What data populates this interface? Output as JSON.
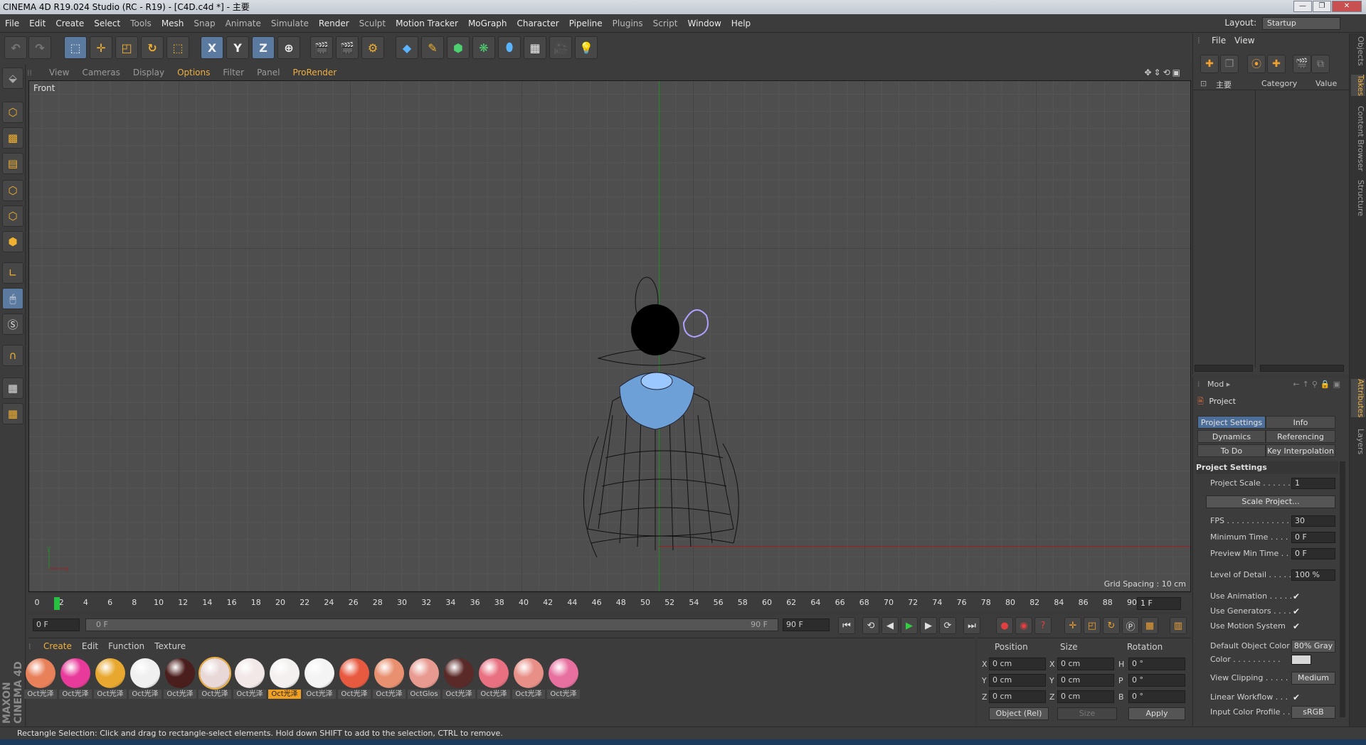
{
  "window": {
    "title": "CINEMA 4D R19.024 Studio (RC - R19) - [C4D.c4d *] - 主要"
  },
  "menu": [
    "File",
    "Edit",
    "Create",
    "Select",
    "Tools",
    "Mesh",
    "Snap",
    "Animate",
    "Simulate",
    "Render",
    "Sculpt",
    "Motion Tracker",
    "MoGraph",
    "Character",
    "Pipeline",
    "Plugins",
    "Script",
    "Window",
    "Help"
  ],
  "layout": {
    "label": "Layout:",
    "value": "Startup"
  },
  "toolbar": {
    "x": "X",
    "y": "Y",
    "z": "Z"
  },
  "viewport": {
    "menu": [
      "View",
      "Cameras",
      "Display",
      "Options",
      "Filter",
      "Panel",
      "ProRender"
    ],
    "label": "Front",
    "grid_spacing": "Grid Spacing : 10 cm"
  },
  "timeline": {
    "ticks": [
      "0",
      "2",
      "4",
      "6",
      "8",
      "10",
      "12",
      "14",
      "16",
      "18",
      "20",
      "22",
      "24",
      "26",
      "28",
      "30",
      "32",
      "34",
      "36",
      "38",
      "40",
      "42",
      "44",
      "46",
      "48",
      "50",
      "52",
      "54",
      "56",
      "58",
      "60",
      "62",
      "64",
      "66",
      "68",
      "70",
      "72",
      "74",
      "76",
      "78",
      "80",
      "82",
      "84",
      "86",
      "88",
      "90"
    ],
    "current_frame": "1 F",
    "start": "0 F",
    "range_start": "0 F",
    "range_end": "90 F",
    "end": "90 F"
  },
  "materials": {
    "tabs": [
      "Create",
      "Edit",
      "Function",
      "Texture"
    ],
    "items": [
      {
        "label": "Oct光泽",
        "color": "#e8805a"
      },
      {
        "label": "Oct光泽",
        "color": "#e83a9a"
      },
      {
        "label": "Oct光泽",
        "color": "#e8a830"
      },
      {
        "label": "Oct光泽",
        "color": "#f0f0f0"
      },
      {
        "label": "Oct光泽",
        "color": "#4a1e1c"
      },
      {
        "label": "Oct光泽",
        "color": "#e8d8d8"
      },
      {
        "label": "Oct光泽",
        "color": "#f2e8e8"
      },
      {
        "label": "Oct光泽",
        "color": "#f4f0f0"
      },
      {
        "label": "Oct光泽",
        "color": "#f4f4f4"
      },
      {
        "label": "Oct光泽",
        "color": "#e85a40"
      },
      {
        "label": "Oct光泽",
        "color": "#e89070"
      },
      {
        "label": "OctGlos",
        "color": "#e89a90"
      },
      {
        "label": "Oct光泽",
        "color": "#5a2a28"
      },
      {
        "label": "Oct光泽",
        "color": "#e87080"
      },
      {
        "label": "Oct光泽",
        "color": "#e89088"
      },
      {
        "label": "Oct光泽",
        "color": "#e870a0"
      }
    ]
  },
  "coords": {
    "headers": [
      "Position",
      "Size",
      "Rotation"
    ],
    "rows": [
      {
        "a1": "X",
        "v1": "0 cm",
        "a2": "X",
        "v2": "0 cm",
        "a3": "H",
        "v3": "0 °"
      },
      {
        "a1": "Y",
        "v1": "0 cm",
        "a2": "Y",
        "v2": "0 cm",
        "a3": "P",
        "v3": "0 °"
      },
      {
        "a1": "Z",
        "v1": "0 cm",
        "a2": "Z",
        "v2": "0 cm",
        "a3": "B",
        "v3": "0 °"
      }
    ],
    "mode": "Object (Rel)",
    "size_mode": "Size",
    "apply": "Apply"
  },
  "objects": {
    "menu": [
      "File",
      "View"
    ],
    "root": "主要",
    "col_category": "Category",
    "col_value": "Value"
  },
  "right_tabs": [
    "Objects",
    "Takes",
    "Content Browser",
    "Structure",
    "Attributes",
    "Layers"
  ],
  "attributes": {
    "mode": "Mod",
    "object": "Project",
    "tabs": [
      "Project Settings",
      "Info",
      "Dynamics",
      "Referencing",
      "To Do",
      "Key Interpolation"
    ],
    "section": "Project Settings",
    "project_scale": {
      "label": "Project Scale . . . . . . .",
      "value": "1"
    },
    "scale_btn": "Scale Project...",
    "fps": {
      "label": "FPS . . . . . . . . . . . . . . .",
      "value": "30"
    },
    "min_time": {
      "label": "Minimum Time . . . . .",
      "value": "0 F"
    },
    "preview_min": {
      "label": "Preview Min Time . . .",
      "value": "0 F"
    },
    "lod": {
      "label": "Level of Detail . . . . . .",
      "value": "100 %"
    },
    "use_anim": {
      "label": "Use Animation . . . . .",
      "value": "✔"
    },
    "use_gen": {
      "label": "Use Generators . . . . .",
      "value": "✔"
    },
    "use_motion": {
      "label": "Use Motion System",
      "value": "✔"
    },
    "def_color": {
      "label": "Default Object Color",
      "value": "80% Gray"
    },
    "color": {
      "label": "Color . . . . . . . . . ."
    },
    "clipping": {
      "label": "View Clipping . . . . .",
      "value": "Medium"
    },
    "linear": {
      "label": "Linear Workflow . . .",
      "value": "✔"
    },
    "profile": {
      "label": "Input Color Profile . .",
      "value": "sRGB"
    }
  },
  "status": "Rectangle Selection: Click and drag to rectangle-select elements. Hold down SHIFT to add to the selection, CTRL to remove.",
  "branding": "MAXON CINEMA 4D"
}
